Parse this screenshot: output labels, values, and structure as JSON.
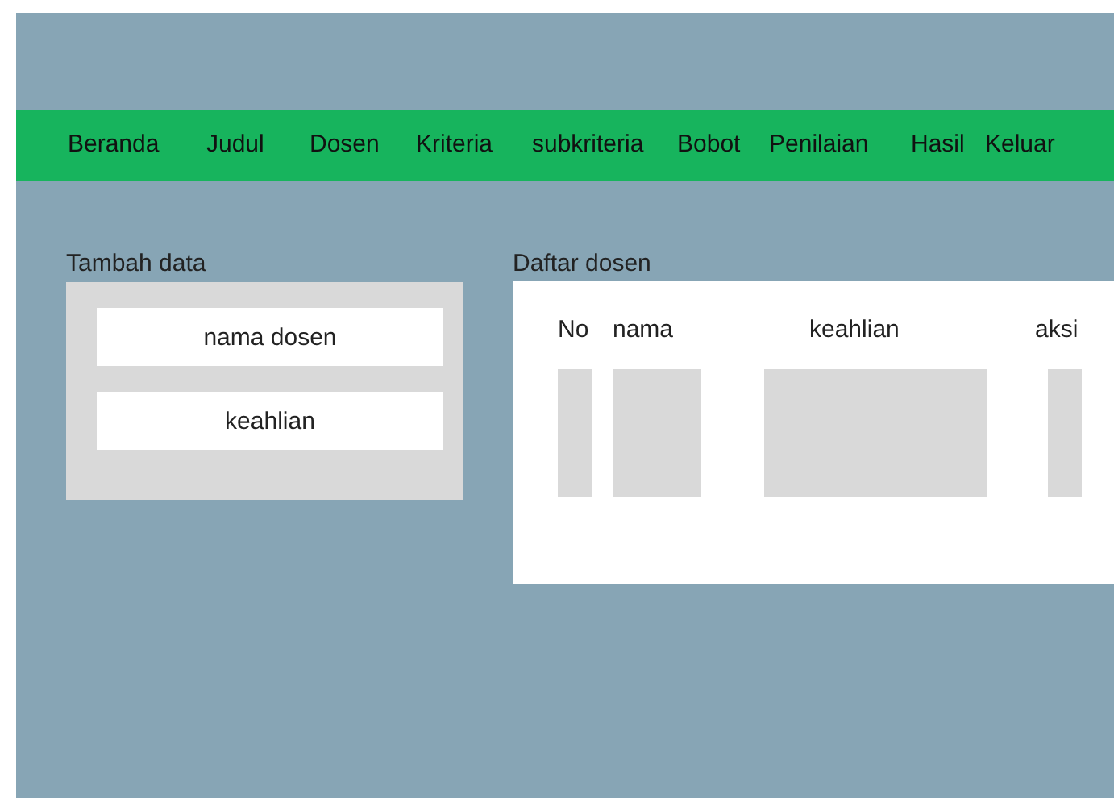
{
  "nav": {
    "items": [
      "Beranda",
      "Judul",
      "Dosen",
      "Kriteria",
      "subkriteria",
      "Bobot",
      "Penilaian",
      "Hasil",
      "Keluar"
    ]
  },
  "add_form": {
    "title": "Tambah data",
    "fields": [
      {
        "placeholder": "nama dosen"
      },
      {
        "placeholder": "keahlian"
      }
    ]
  },
  "list": {
    "title": "Daftar dosen",
    "columns": [
      "No",
      "nama",
      "keahlian",
      "aksi"
    ]
  }
}
